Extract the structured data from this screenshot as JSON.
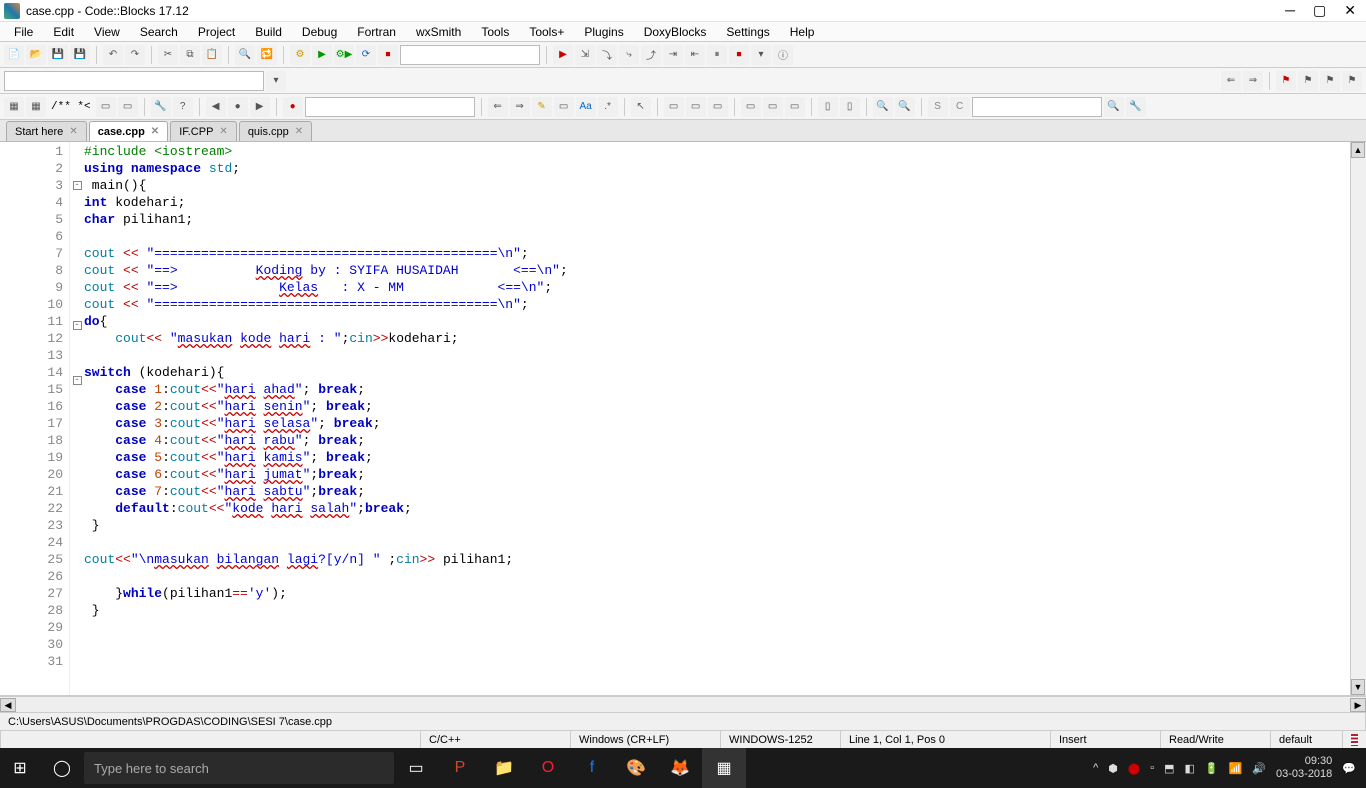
{
  "window": {
    "title": "case.cpp - Code::Blocks 17.12"
  },
  "menu": [
    "File",
    "Edit",
    "View",
    "Search",
    "Project",
    "Build",
    "Debug",
    "Fortran",
    "wxSmith",
    "Tools",
    "Tools+",
    "Plugins",
    "DoxyBlocks",
    "Settings",
    "Help"
  ],
  "tabs": [
    {
      "label": "Start here",
      "active": false
    },
    {
      "label": "case.cpp",
      "active": true
    },
    {
      "label": "IF.CPP",
      "active": false
    },
    {
      "label": "quis.cpp",
      "active": false
    }
  ],
  "comment_token": "/** *<",
  "code_lines": [
    {
      "n": 1,
      "html": "<span class='pp'>#include &lt;iostream&gt;</span>"
    },
    {
      "n": 2,
      "html": "<span class='kw'>using</span> <span class='kw'>namespace</span> <span class='kw2'>std</span>;"
    },
    {
      "n": 3,
      "fold": "[-]",
      "html": " main(){"
    },
    {
      "n": 4,
      "html": "<span class='kw'>int</span> kodehari;"
    },
    {
      "n": 5,
      "html": "<span class='kw'>char</span> pilihan1;"
    },
    {
      "n": 6,
      "html": ""
    },
    {
      "n": 7,
      "html": "<span class='kw2'>cout</span> <span class='op'>&lt;&lt;</span> <span class='str'>\"============================================\\n\"</span>;"
    },
    {
      "n": 8,
      "html": "<span class='kw2'>cout</span> <span class='op'>&lt;&lt;</span> <span class='str'>\"==&gt;          </span><span class='str und'>Koding</span><span class='str'> by : SYIFA HUSAIDAH       &lt;==\\n\"</span>;"
    },
    {
      "n": 9,
      "html": "<span class='kw2'>cout</span> <span class='op'>&lt;&lt;</span> <span class='str'>\"==&gt;             </span><span class='str und'>Kelas</span><span class='str'>   : X - MM            &lt;==\\n\"</span>;"
    },
    {
      "n": 10,
      "html": "<span class='kw2'>cout</span> <span class='op'>&lt;&lt;</span> <span class='str'>\"============================================\\n\"</span>;"
    },
    {
      "n": 11,
      "fold": "[-]",
      "html": "<span class='kw'>do</span>{"
    },
    {
      "n": 12,
      "html": "    <span class='kw2'>cout</span><span class='op'>&lt;&lt;</span> <span class='str'>\"</span><span class='str und'>masukan</span><span class='str'> </span><span class='str und'>kode</span><span class='str'> </span><span class='str und'>hari</span><span class='str'> : \"</span>;<span class='kw2'>cin</span><span class='op'>&gt;&gt;</span>kodehari;"
    },
    {
      "n": 13,
      "html": ""
    },
    {
      "n": 14,
      "fold": "[-]",
      "html": "<span class='kw'>switch</span> (kodehari){"
    },
    {
      "n": 15,
      "html": "    <span class='kw'>case</span> <span class='num'>1</span>:<span class='kw2'>cout</span><span class='op'>&lt;&lt;</span><span class='str'>\"</span><span class='str und'>hari</span><span class='str'> </span><span class='str und'>ahad</span><span class='str'>\"</span>; <span class='kw'>break</span>;"
    },
    {
      "n": 16,
      "html": "    <span class='kw'>case</span> <span class='num'>2</span>:<span class='kw2'>cout</span><span class='op'>&lt;&lt;</span><span class='str'>\"</span><span class='str und'>hari</span><span class='str'> </span><span class='str und'>senin</span><span class='str'>\"</span>; <span class='kw'>break</span>;"
    },
    {
      "n": 17,
      "html": "    <span class='kw'>case</span> <span class='num'>3</span>:<span class='kw2'>cout</span><span class='op'>&lt;&lt;</span><span class='str'>\"</span><span class='str und'>hari</span><span class='str'> </span><span class='str und'>selasa</span><span class='str'>\"</span>; <span class='kw'>break</span>;"
    },
    {
      "n": 18,
      "html": "    <span class='kw'>case</span> <span class='num'>4</span>:<span class='kw2'>cout</span><span class='op'>&lt;&lt;</span><span class='str'>\"</span><span class='str und'>hari</span><span class='str'> </span><span class='str und'>rabu</span><span class='str'>\"</span>; <span class='kw'>break</span>;"
    },
    {
      "n": 19,
      "html": "    <span class='kw'>case</span> <span class='num'>5</span>:<span class='kw2'>cout</span><span class='op'>&lt;&lt;</span><span class='str'>\"</span><span class='str und'>hari</span><span class='str'> </span><span class='str und'>kamis</span><span class='str'>\"</span>; <span class='kw'>break</span>;"
    },
    {
      "n": 20,
      "html": "    <span class='kw'>case</span> <span class='num'>6</span>:<span class='kw2'>cout</span><span class='op'>&lt;&lt;</span><span class='str'>\"</span><span class='str und'>hari</span><span class='str'> </span><span class='str und'>jumat</span><span class='str'>\"</span>;<span class='kw'>break</span>;"
    },
    {
      "n": 21,
      "html": "    <span class='kw'>case</span> <span class='num'>7</span>:<span class='kw2'>cout</span><span class='op'>&lt;&lt;</span><span class='str'>\"</span><span class='str und'>hari</span><span class='str'> </span><span class='str und'>sabtu</span><span class='str'>\"</span>;<span class='kw'>break</span>;"
    },
    {
      "n": 22,
      "html": "    <span class='kw'>default</span>:<span class='kw2'>cout</span><span class='op'>&lt;&lt;</span><span class='str'>\"</span><span class='str und'>kode</span><span class='str'> </span><span class='str und'>hari</span><span class='str'> </span><span class='str und'>salah</span><span class='str'>\"</span>;<span class='kw'>break</span>;"
    },
    {
      "n": 23,
      "html": " }"
    },
    {
      "n": 24,
      "html": ""
    },
    {
      "n": 25,
      "html": "<span class='kw2'>cout</span><span class='op'>&lt;&lt;</span><span class='str'>\"\\n</span><span class='str und'>masukan</span><span class='str'> </span><span class='str und'>bilangan</span><span class='str'> </span><span class='str und'>lagi</span><span class='str'>?[y/n] \"</span> ;<span class='kw2'>cin</span><span class='op'>&gt;&gt;</span> pilihan1;"
    },
    {
      "n": 26,
      "html": ""
    },
    {
      "n": 27,
      "html": "    }<span class='kw'>while</span>(pilihan1<span class='op'>==</span><span class='str'>'y'</span>);"
    },
    {
      "n": 28,
      "html": " }"
    },
    {
      "n": 29,
      "html": ""
    },
    {
      "n": 30,
      "html": ""
    },
    {
      "n": 31,
      "html": ""
    }
  ],
  "status_path": "C:\\Users\\ASUS\\Documents\\PROGDAS\\CODING\\SESI 7\\case.cpp",
  "status": {
    "lang": "C/C++",
    "eol": "Windows (CR+LF)",
    "enc": "WINDOWS-1252",
    "pos": "Line 1, Col 1, Pos 0",
    "ins": "Insert",
    "rw": "Read/Write",
    "prof": "default"
  },
  "taskbar": {
    "search_placeholder": "Type here to search",
    "time": "09:30",
    "date": "03-03-2018"
  }
}
